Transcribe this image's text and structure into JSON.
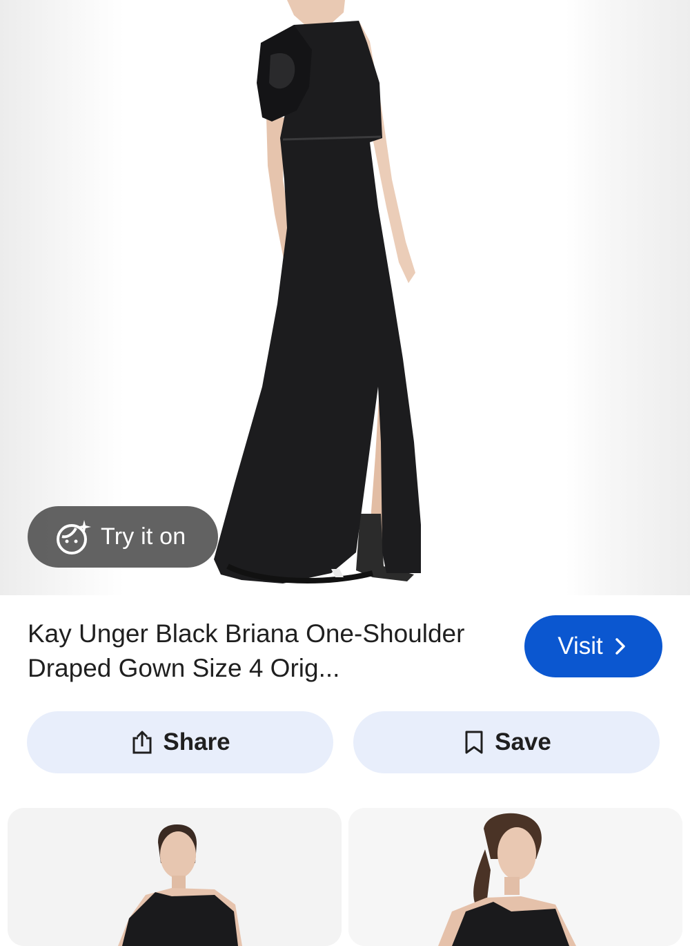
{
  "hero": {
    "image_alt": "Black one-shoulder draped gown on model",
    "try_on_label": "Try it on"
  },
  "product": {
    "title": "Kay Unger Black Briana One-Shoulder Draped Gown Size 4 Orig...",
    "visit_label": "Visit"
  },
  "actions": {
    "share_label": "Share",
    "save_label": "Save"
  },
  "related": [
    {
      "alt": "Model in black one-shoulder gown, front view"
    },
    {
      "alt": "Model in black one-shoulder gown, side view"
    }
  ],
  "colors": {
    "primary_button": "#0b57d0",
    "pill_background": "#e8eefb",
    "overlay_chip": "#555555"
  }
}
